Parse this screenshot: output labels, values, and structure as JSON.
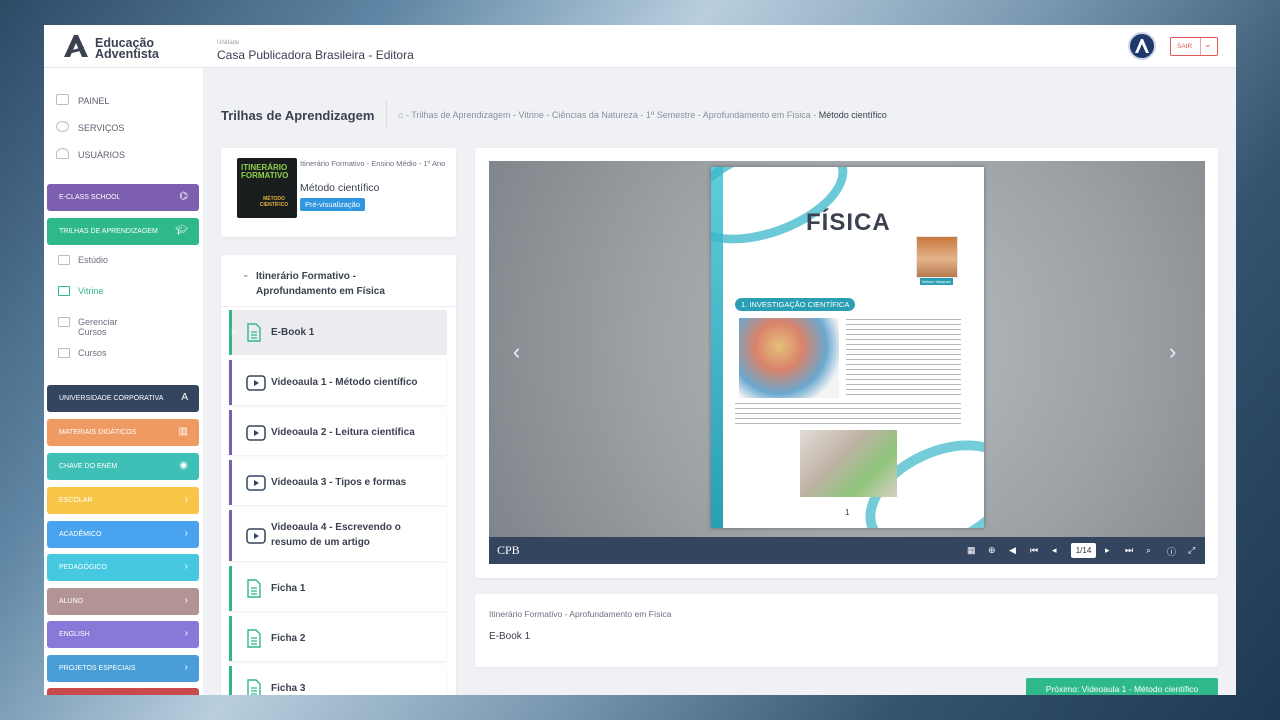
{
  "header": {
    "logo_line1": "Educação",
    "logo_line2": "Adventista",
    "unit_caption": "Unidade",
    "unit_name": "Casa Publicadora Brasileira - Editora",
    "logout_label": "SAIR"
  },
  "sidebar": {
    "top_items": [
      {
        "label": "PAINEL",
        "icon": "dashboard-icon"
      },
      {
        "label": "SERVIÇOS",
        "icon": "services-icon"
      },
      {
        "label": "USUÁRIOS",
        "icon": "users-icon"
      }
    ],
    "eclass": {
      "label": "E-CLASS SCHOOL",
      "color": "#7d5fb0"
    },
    "trilhas": {
      "label": "TRILHAS DE APRENDIZAGEM",
      "color": "#2fb98a"
    },
    "trilhas_sub": [
      "Estúdio",
      "Vitrine",
      "Gerenciar Cursos",
      "Cursos"
    ],
    "modules": [
      {
        "label": "UNIVERSIDADE CORPORATIVA",
        "color": "#34455f"
      },
      {
        "label": "MATERIAIS DIDÁTICOS",
        "color": "#ef9a62"
      },
      {
        "label": "CHAVE DO ENEM",
        "color": "#3fc0b6"
      },
      {
        "label": "ESCOLAR",
        "color": "#f7c548"
      },
      {
        "label": "ACADÊMICO",
        "color": "#4aa3ef"
      },
      {
        "label": "PEDAGÓGICO",
        "color": "#45c8e0"
      },
      {
        "label": "ALUNO",
        "color": "#b39494"
      },
      {
        "label": "ENGLISH",
        "color": "#8a78d8"
      },
      {
        "label": "PROJETOS ESPECIAIS",
        "color": "#4a9ed8"
      }
    ]
  },
  "main": {
    "page_title": "Trilhas de Aprendizagem",
    "breadcrumb": "- Trilhas de Aprendizagem - Vitrine - Ciências da Natureza - 1º Semestre - Aprofundamento em Física -",
    "breadcrumb_current": "Método científico",
    "course": {
      "thumb_line1": "ITINERÁRIO FORMATIVO",
      "thumb_line2": "MÉTODO CIENTÍFICO",
      "subtitle": "Itinerário Formativo - Ensino Médio - 1º Ano",
      "title": "Método científico",
      "badge": "Pré-visualização"
    },
    "module_title": "Itinerário Formativo - Aprofundamento em Física",
    "lessons": [
      {
        "label": "E-Book 1",
        "type": "ebook"
      },
      {
        "label": "Videoaula 1 - Método científico",
        "type": "video"
      },
      {
        "label": "Videoaula 2 - Leitura científica",
        "type": "video"
      },
      {
        "label": "Videoaula 3 - Tipos e formas",
        "type": "video"
      },
      {
        "label": "Videoaula 4 - Escrevendo o resumo de um artigo",
        "type": "video"
      },
      {
        "label": "Ficha 1",
        "type": "ebook"
      },
      {
        "label": "Ficha 2",
        "type": "ebook"
      },
      {
        "label": "Ficha 3",
        "type": "ebook"
      }
    ],
    "viewer": {
      "book_title": "FÍSICA",
      "section_label": "1. INVESTIGAÇÃO CIENTÍFICA",
      "author": "Nelson Vasquez",
      "page_number": "1",
      "page_indicator": "1/14",
      "brand": "CPB"
    },
    "info": {
      "subtitle": "Itinerário Formativo - Aprofundamento em Física",
      "title": "E-Book 1"
    },
    "next_button": "Próximo: Videoaula 1 - Método científico"
  }
}
